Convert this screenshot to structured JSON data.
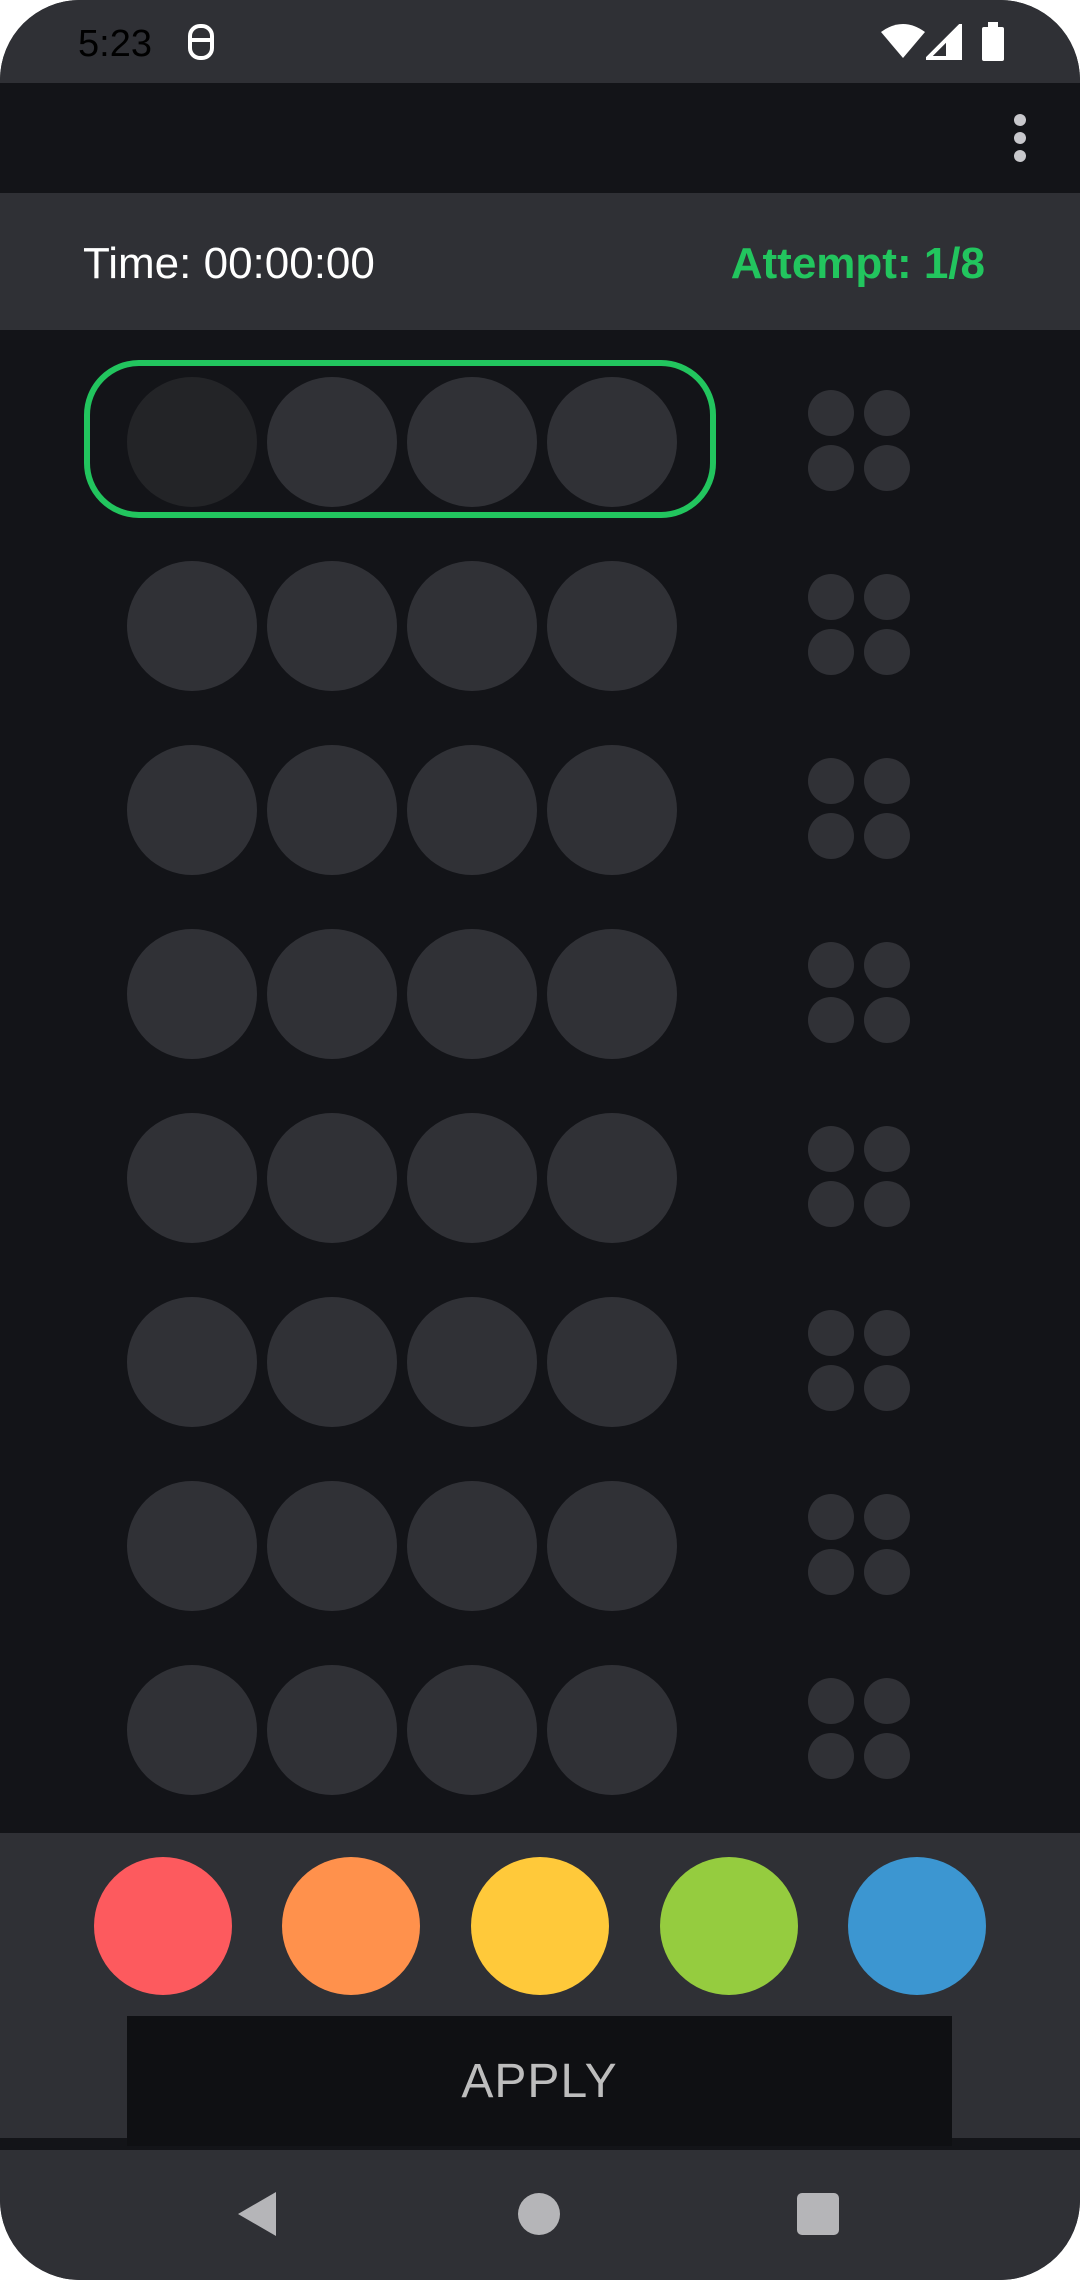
{
  "status_bar": {
    "time": "5:23",
    "icons": [
      "notification-app-icon",
      "wifi-icon",
      "signal-icon",
      "battery-icon"
    ]
  },
  "toolbar": {
    "overflow_icon": "more-vert-icon"
  },
  "info_bar": {
    "timer": "Time: 00:00:00",
    "attempt": "Attempt: 1/8",
    "attempt_color": "#22c55e"
  },
  "board": {
    "rows": 8,
    "pegs_per_row": 4,
    "feedback_per_row": 4,
    "active_row": 1,
    "active_peg": 1,
    "empty_color": "#303136",
    "highlight_color": "#22c55e"
  },
  "palette": {
    "colors": [
      {
        "name": "red",
        "hex": "#fd5a5e"
      },
      {
        "name": "orange",
        "hex": "#ff914c"
      },
      {
        "name": "yellow",
        "hex": "#ffc93a"
      },
      {
        "name": "green",
        "hex": "#95cc3f"
      },
      {
        "name": "blue",
        "hex": "#3c96d1"
      }
    ]
  },
  "apply_button": {
    "label": "APPLY"
  },
  "nav_bar": {
    "icons": [
      "back-icon",
      "home-icon",
      "recents-icon"
    ]
  }
}
